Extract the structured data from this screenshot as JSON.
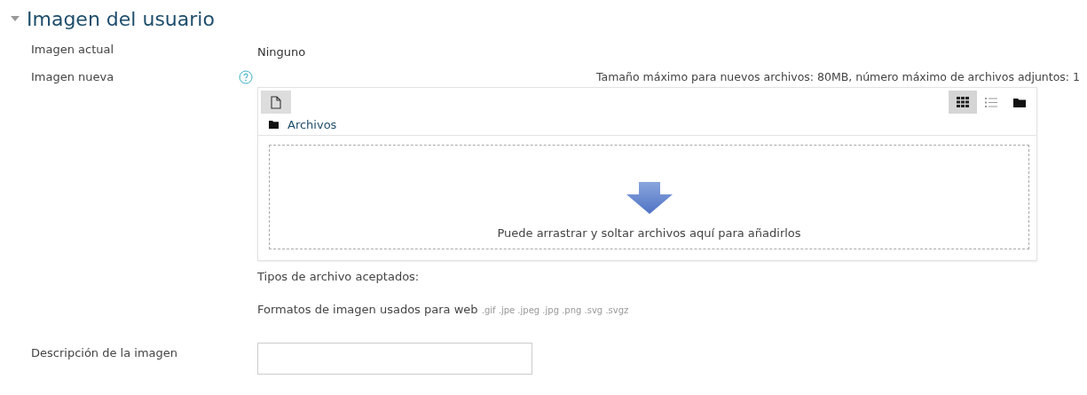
{
  "section": {
    "title": "Imagen del usuario",
    "expanded": true
  },
  "current_image": {
    "label": "Imagen actual",
    "value": "Ninguno"
  },
  "new_image": {
    "label": "Imagen nueva",
    "limits": "Tamaño máximo para nuevos archivos: 80MB, número máximo de archivos adjuntos: 1",
    "views": [
      {
        "kind": "icons",
        "selected": true
      },
      {
        "kind": "list",
        "selected": false
      },
      {
        "kind": "tree",
        "selected": false
      }
    ],
    "folder": "Archivos",
    "dropzone_text": "Puede arrastrar y soltar archivos aquí para añadirlos",
    "accepted_label": "Tipos de archivo aceptados:",
    "accepted_group": "Formatos de imagen usados para web",
    "accepted_extensions": ".gif .jpe .jpeg .jpg .png .svg .svgz"
  },
  "description": {
    "label": "Descripción de la imagen"
  }
}
